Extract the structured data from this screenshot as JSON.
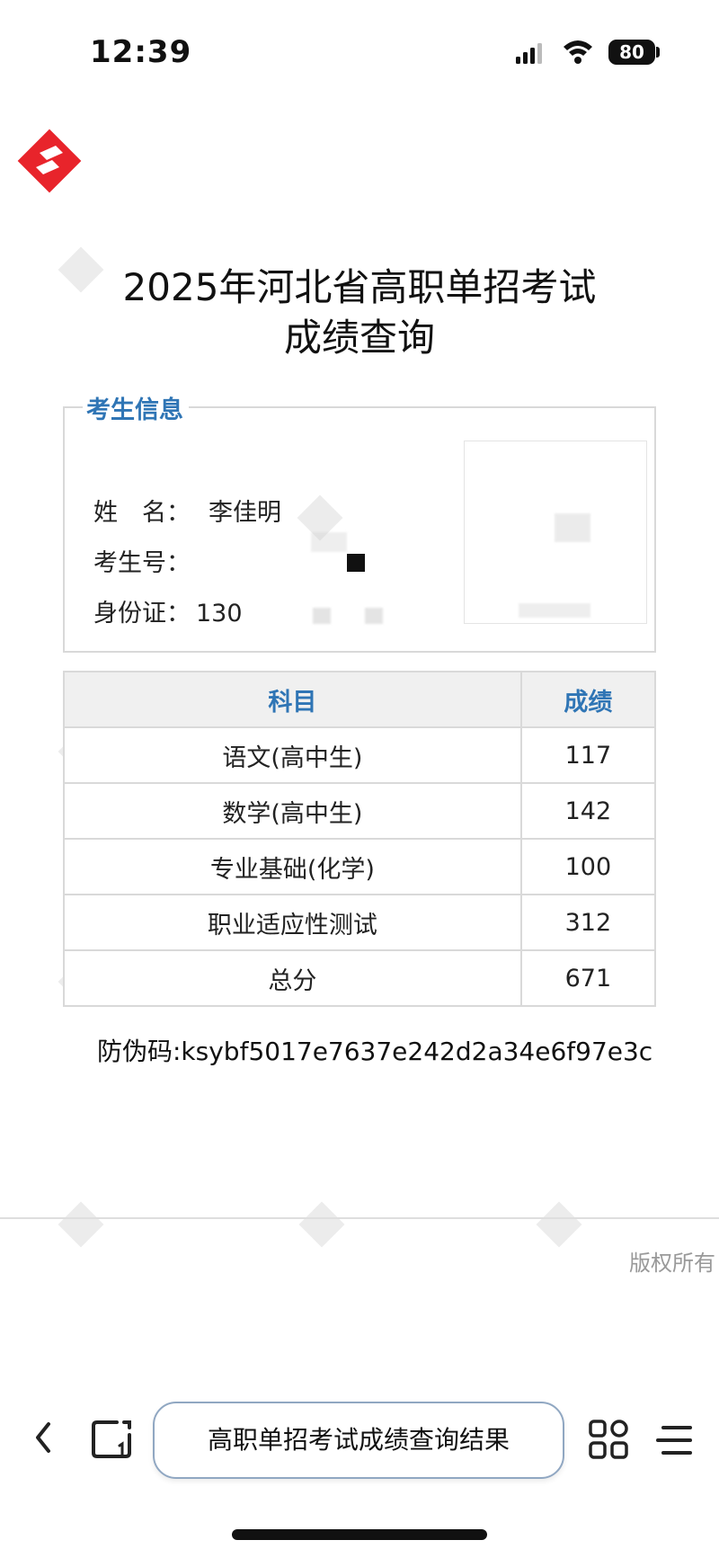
{
  "status_bar": {
    "time": "12:39",
    "battery": "80"
  },
  "page": {
    "title_line1": "2025年河北省高职单招考试",
    "title_line2": "成绩查询"
  },
  "info": {
    "legend": "考生信息",
    "name_label": "姓　名：",
    "name_value": "李佳明",
    "exam_no_label": "考生号：",
    "id_label": "身份证：",
    "id_value": "130"
  },
  "scores": {
    "headers": [
      "科目",
      "成绩"
    ],
    "rows": [
      {
        "subject": "语文(高中生)",
        "score": "117"
      },
      {
        "subject": "数学(高中生)",
        "score": "142"
      },
      {
        "subject": "专业基础(化学)",
        "score": "100"
      },
      {
        "subject": "职业适应性测试",
        "score": "312"
      },
      {
        "subject": "总分",
        "score": "671"
      }
    ]
  },
  "anti_fake": "防伪码:ksybf5017e7637e242d2a34e6f97e3c",
  "footer": {
    "copyright": "版权所有"
  },
  "browser": {
    "address_text": "高职单招考试成绩查询结果"
  },
  "colors": {
    "accent": "#2f75b5",
    "logo": "#e8242b"
  },
  "icons": [
    "signal-icon",
    "wifi-icon",
    "battery-icon",
    "site-logo-icon",
    "back-icon",
    "pages-icon",
    "grid-icon",
    "menu-icon"
  ]
}
